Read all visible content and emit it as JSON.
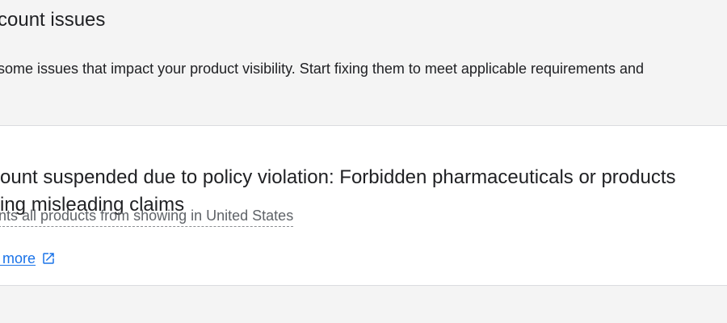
{
  "header": {
    "title": "count issues",
    "description": "some issues that impact your product visibility. Start fixing them to meet applicable requirements and"
  },
  "issue": {
    "title_line_1": "count suspended due to policy violation: Forbidden pharmaceuticals or products",
    "title_line_2": "king misleading claims",
    "impact": "ents all products from showing in United States",
    "learn_more_label": "n more",
    "learn_more_icon": "external-link-icon"
  },
  "colors": {
    "background": "#f4f4f4",
    "card_background": "#ffffff",
    "primary_text": "#202124",
    "secondary_text": "#5f6368",
    "link": "#1a73e8",
    "divider": "#dadce0"
  }
}
